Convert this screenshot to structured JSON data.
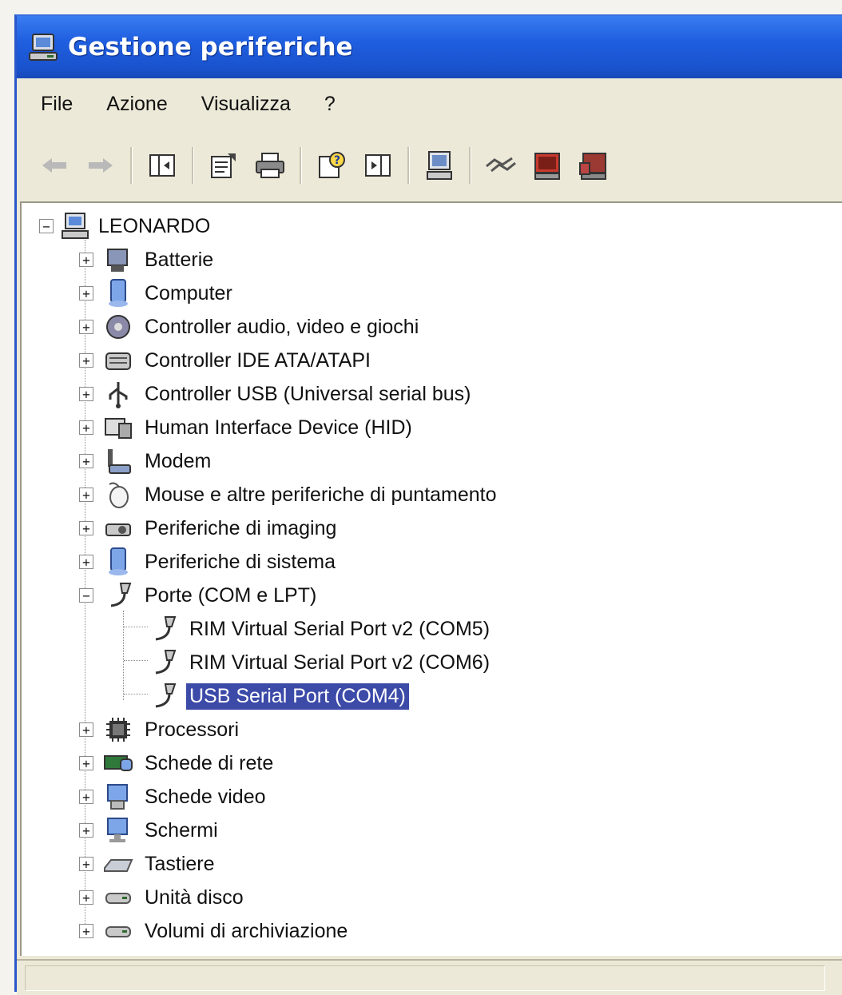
{
  "window": {
    "title": "Gestione periferiche"
  },
  "menu": [
    "File",
    "Azione",
    "Visualizza",
    "?"
  ],
  "toolbar": {
    "buttons": [
      "back-icon",
      "forward-icon",
      "show-hide-tree-icon",
      "properties-icon",
      "print-icon",
      "help-icon",
      "show-hide-action-pane-icon",
      "scan-hardware-icon",
      "update-driver-icon",
      "uninstall-icon",
      "disable-icon"
    ]
  },
  "tree": {
    "root": "LEONARDO",
    "categories": [
      {
        "label": "Batterie",
        "icon": "battery-icon",
        "expanded": false
      },
      {
        "label": "Computer",
        "icon": "computer-icon",
        "expanded": false
      },
      {
        "label": "Controller audio, video e giochi",
        "icon": "audio-icon",
        "expanded": false
      },
      {
        "label": "Controller IDE ATA/ATAPI",
        "icon": "ide-controller-icon",
        "expanded": false
      },
      {
        "label": "Controller USB (Universal serial bus)",
        "icon": "usb-icon",
        "expanded": false
      },
      {
        "label": "Human Interface Device (HID)",
        "icon": "hid-icon",
        "expanded": false
      },
      {
        "label": "Modem",
        "icon": "modem-icon",
        "expanded": false
      },
      {
        "label": "Mouse e altre periferiche di puntamento",
        "icon": "mouse-icon",
        "expanded": false
      },
      {
        "label": "Periferiche di imaging",
        "icon": "imaging-icon",
        "expanded": false
      },
      {
        "label": "Periferiche di sistema",
        "icon": "system-device-icon",
        "expanded": false
      },
      {
        "label": "Porte (COM e LPT)",
        "icon": "port-icon",
        "expanded": true,
        "children": [
          {
            "label": "RIM Virtual Serial Port v2 (COM5)",
            "selected": false
          },
          {
            "label": "RIM Virtual Serial Port v2 (COM6)",
            "selected": false
          },
          {
            "label": "USB Serial Port (COM4)",
            "selected": true
          }
        ]
      },
      {
        "label": "Processori",
        "icon": "processor-icon",
        "expanded": false
      },
      {
        "label": "Schede di rete",
        "icon": "network-card-icon",
        "expanded": false
      },
      {
        "label": "Schede video",
        "icon": "video-card-icon",
        "expanded": false
      },
      {
        "label": "Schermi",
        "icon": "monitor-icon",
        "expanded": false
      },
      {
        "label": "Tastiere",
        "icon": "keyboard-icon",
        "expanded": false
      },
      {
        "label": "Unità disco",
        "icon": "disk-drive-icon",
        "expanded": false
      },
      {
        "label": "Volumi di archiviazione",
        "icon": "storage-volume-icon",
        "expanded": false
      }
    ]
  },
  "expander": {
    "collapsed": "+",
    "expanded": "−"
  },
  "colors": {
    "titlebar": "#1f5fe0",
    "selection": "#3c4aa8"
  }
}
